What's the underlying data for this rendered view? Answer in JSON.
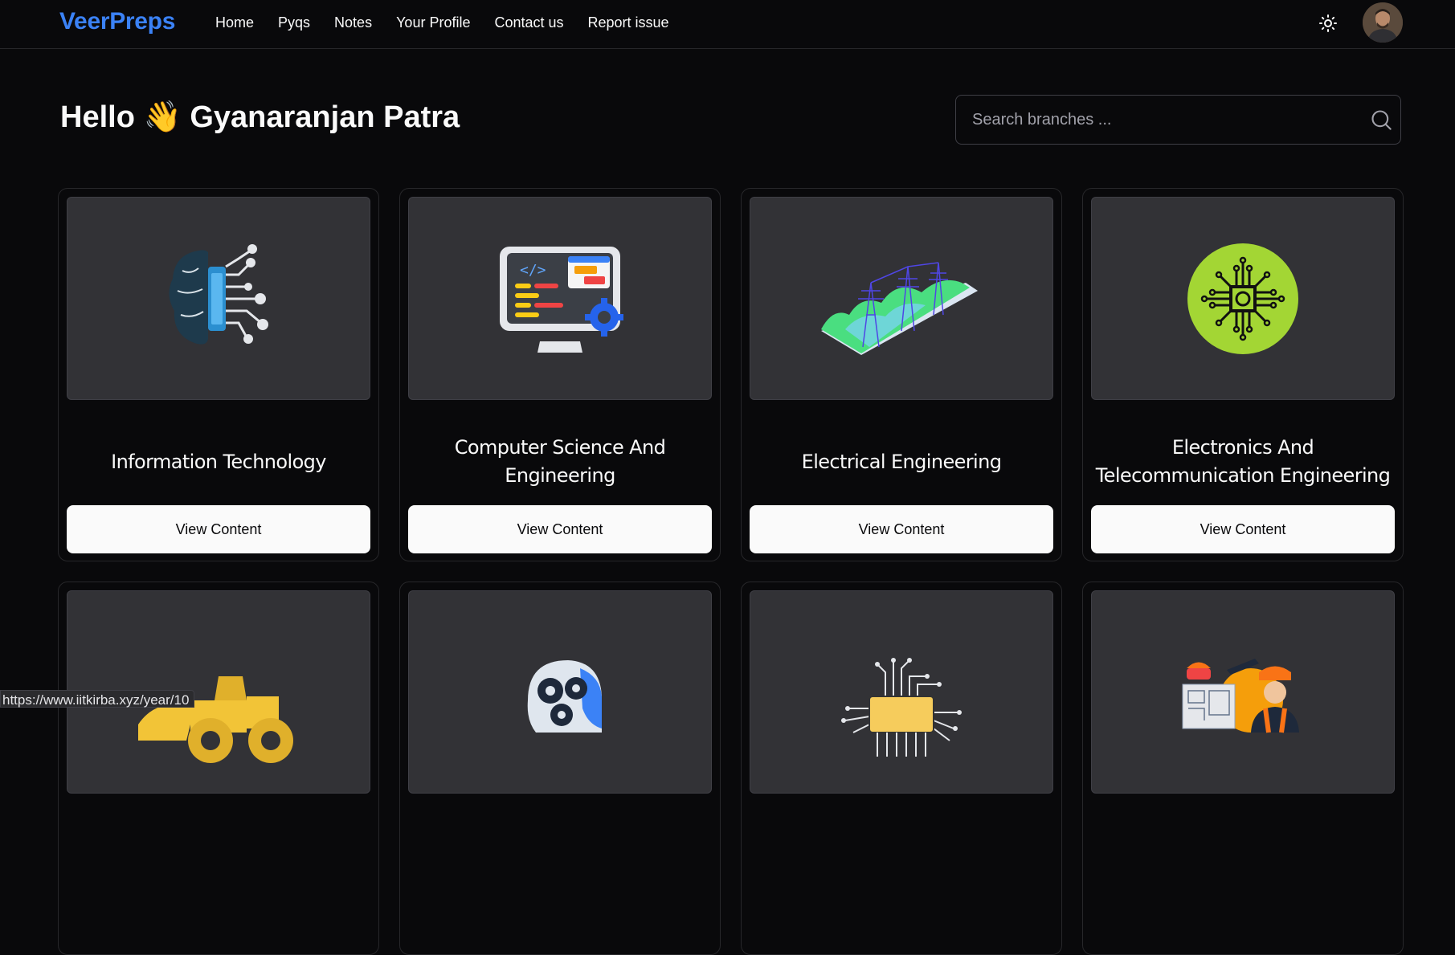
{
  "nav": {
    "brand": "VeerPreps",
    "links": [
      "Home",
      "Pyqs",
      "Notes",
      "Your Profile",
      "Contact us",
      "Report issue"
    ],
    "theme_icon": "sun-icon",
    "avatar_icon": "user-avatar"
  },
  "header": {
    "greeting": "Hello 👋 Gyanaranjan Patra"
  },
  "search": {
    "placeholder": "Search branches ...",
    "value": "",
    "icon": "search-icon"
  },
  "branches": [
    {
      "title": "Information Technology",
      "button": "View Content",
      "icon": "brain-circuit-icon"
    },
    {
      "title": "Computer Science And Engineering",
      "button": "View Content",
      "icon": "computer-code-icon"
    },
    {
      "title": "Electrical Engineering",
      "button": "View Content",
      "icon": "power-tower-icon"
    },
    {
      "title": "Electronics And Telecommunication Engineering",
      "button": "View Content",
      "icon": "microchip-circle-icon"
    },
    {
      "title": "",
      "button": "",
      "icon": "bulldozer-icon"
    },
    {
      "title": "",
      "button": "",
      "icon": "head-gears-icon"
    },
    {
      "title": "",
      "button": "",
      "icon": "processor-chip-icon"
    },
    {
      "title": "",
      "button": "",
      "icon": "engineer-blueprint-icon"
    }
  ],
  "status_bar": {
    "url": "https://www.iitkirba.xyz/year/10"
  },
  "colors": {
    "background": "#09090b",
    "brand": "#3b82f6",
    "card_image_bg": "#323236",
    "button_bg": "#fafafa"
  }
}
